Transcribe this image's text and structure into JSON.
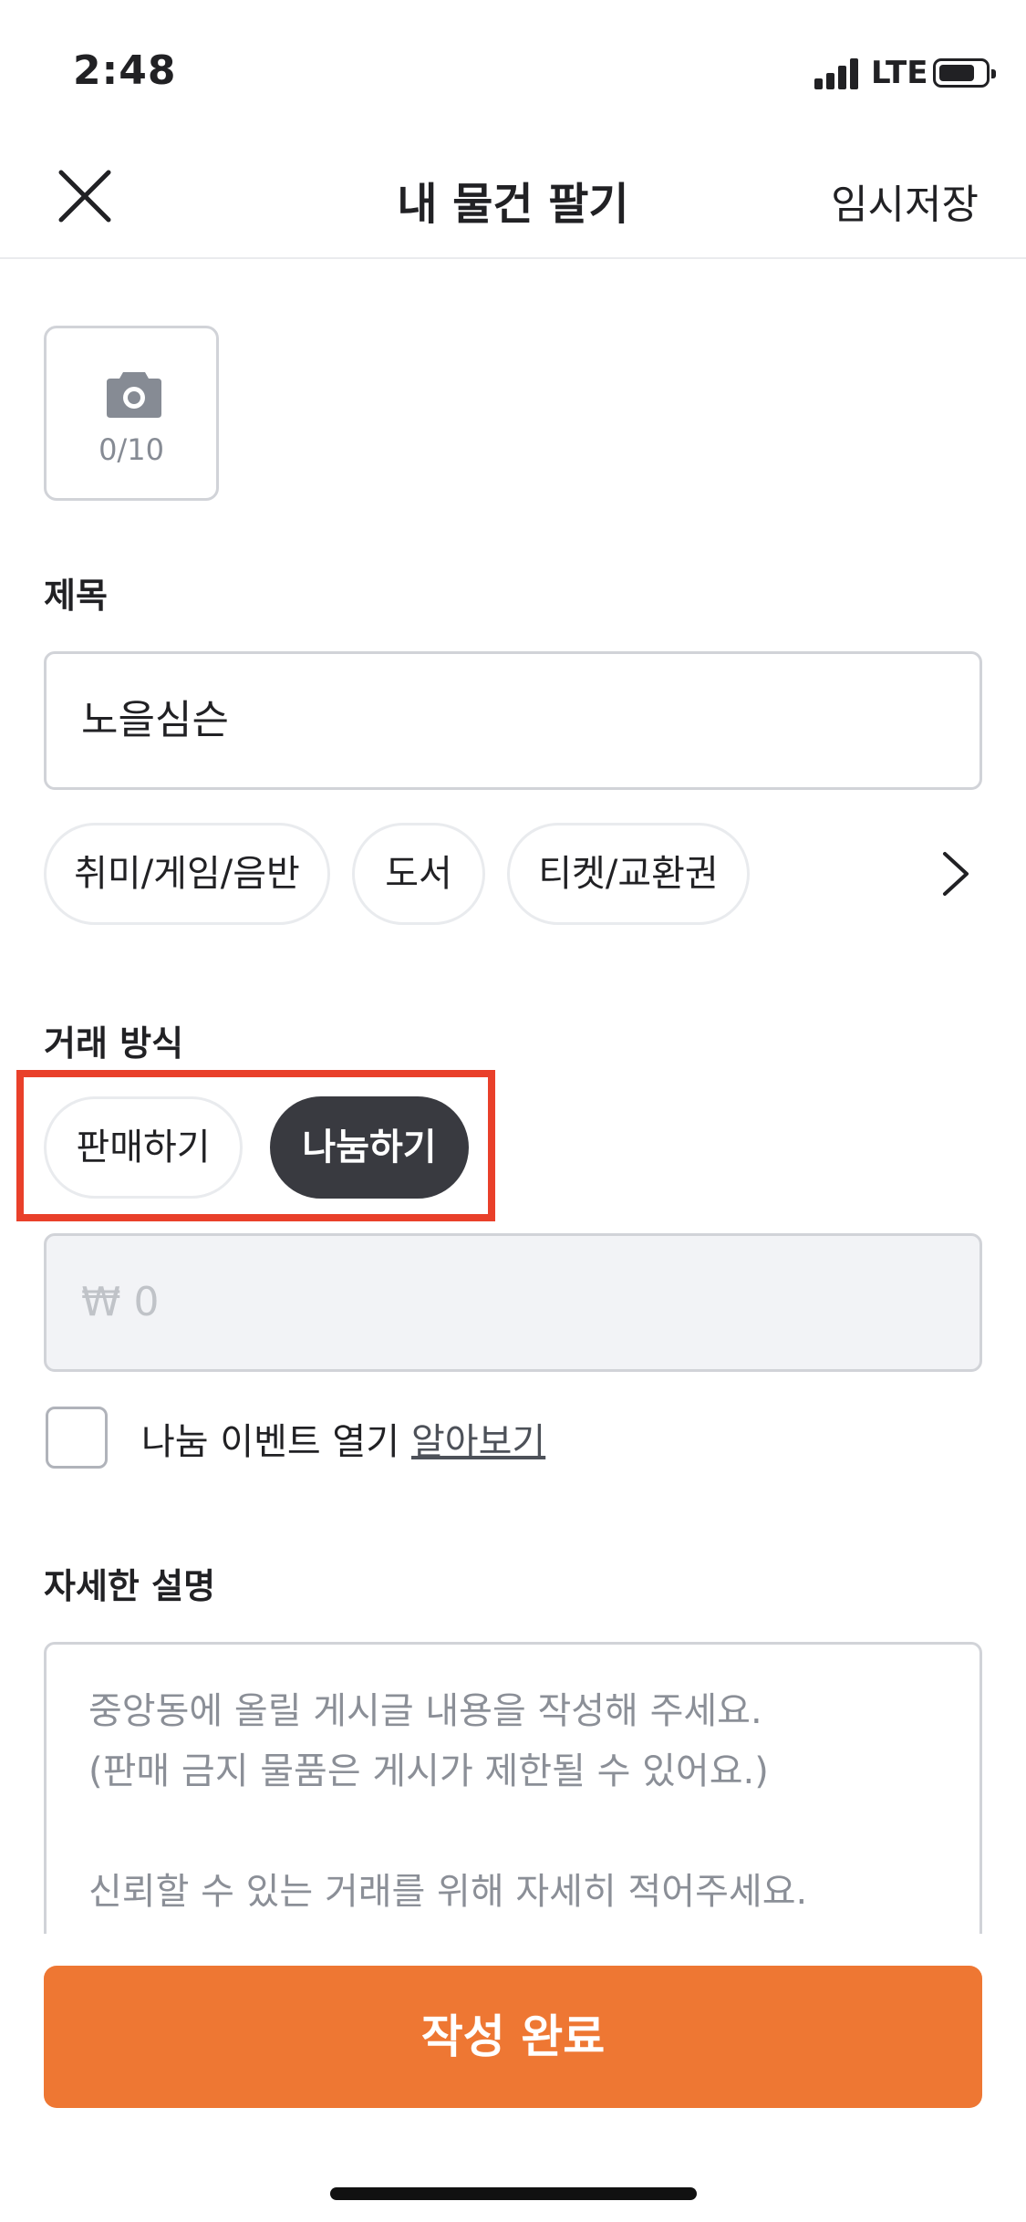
{
  "status_bar": {
    "time": "2:48",
    "network": "LTE",
    "battery_level": 0.65
  },
  "header": {
    "close_icon": "close-icon",
    "title": "내 물건 팔기",
    "save_label": "임시저장"
  },
  "photo": {
    "icon": "camera-icon",
    "count_text": "0/10"
  },
  "title_section": {
    "label": "제목",
    "value": "노을심슨"
  },
  "categories": {
    "chips": [
      "취미/게임/음반",
      "도서",
      "티켓/교환권"
    ],
    "more_icon": "chevron-right-icon"
  },
  "trade": {
    "label": "거래 방식",
    "options": [
      "판매하기",
      "나눔하기"
    ],
    "selected": "나눔하기"
  },
  "price": {
    "placeholder": "₩ 0"
  },
  "share_event": {
    "checked": false,
    "label": "나눔 이벤트 열기",
    "link": "알아보기"
  },
  "description": {
    "label": "자세한 설명",
    "placeholder": "중앙동에 올릴 게시글 내용을 작성해 주세요.\n(판매 금지 물품은 게시가 제한될 수 있어요.)\n\n신뢰할 수 있는 거래를 위해 자세히 적어주세요."
  },
  "submit": {
    "label": "작성 완료"
  },
  "colors": {
    "accent": "#ee7733",
    "selected_pill": "#393a40",
    "highlight": "#e9402a"
  }
}
